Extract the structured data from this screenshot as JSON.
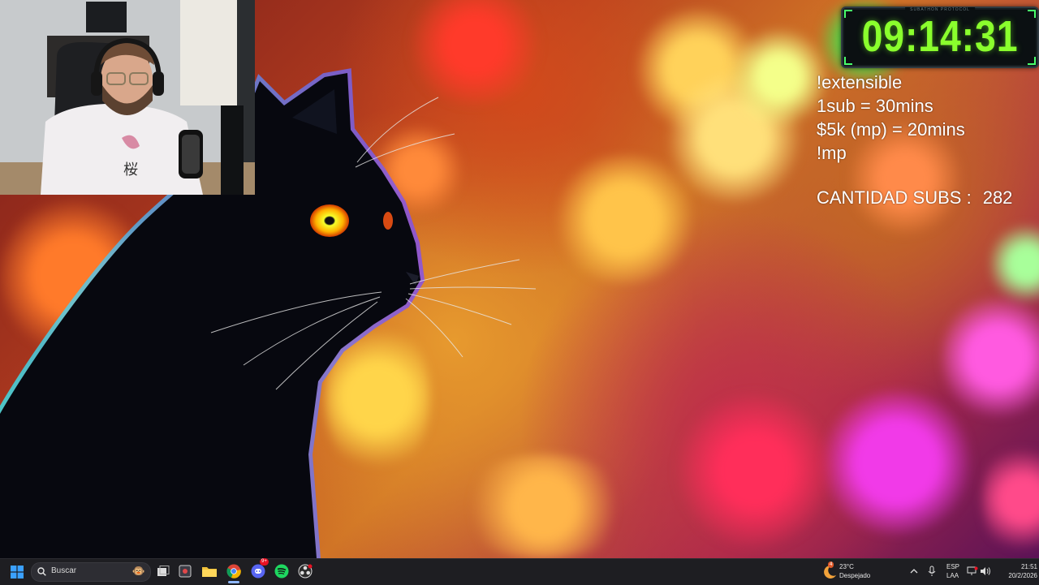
{
  "overlay": {
    "timer": "09:14:31",
    "timer_caption": "SUBATHON PROTOCOL",
    "lines": [
      "!extensible",
      "1sub = 30mins",
      "$5k (mp) = 20mins",
      "!mp"
    ],
    "subs_label": "CANTIDAD SUBS :",
    "subs_count": "282"
  },
  "taskbar": {
    "search_placeholder": "Buscar",
    "pinned_icons": [
      "start-icon",
      "search-icon",
      "task-view-icon",
      "snipping-icon",
      "file-explorer-icon",
      "chrome-icon",
      "discord-icon",
      "spotify-icon",
      "obs-icon"
    ],
    "discord_badge": "9+",
    "weather": {
      "temp": "23°C",
      "condition": "Despejado",
      "badge": "4"
    },
    "language": {
      "code": "ESP",
      "layout": "LAA"
    },
    "clock": {
      "time": "21:51",
      "date": "20/2/2026"
    }
  },
  "colors": {
    "timer_green": "#8aff2d",
    "taskbar_bg": "#1e1e22"
  }
}
